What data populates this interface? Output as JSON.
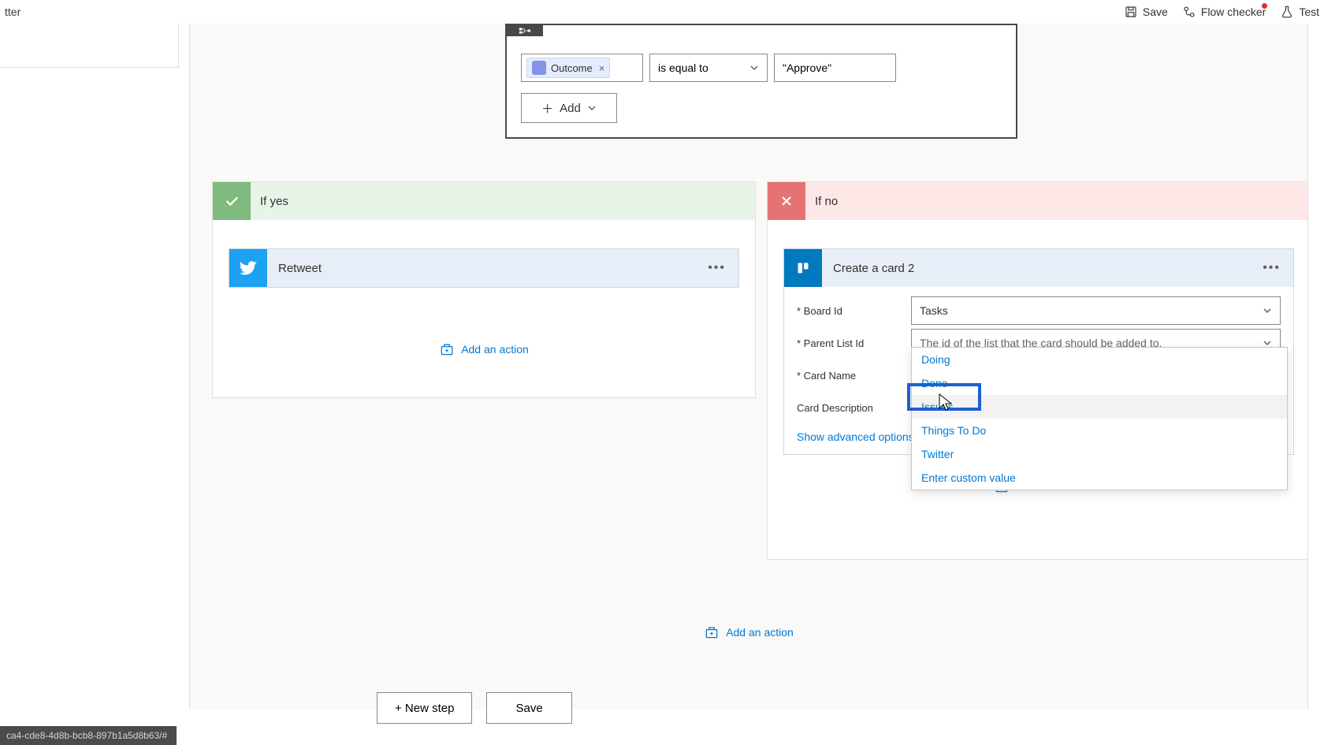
{
  "topbar": {
    "title_fragment": "tter",
    "save": "Save",
    "flow_checker": "Flow checker",
    "test": "Test"
  },
  "condition": {
    "token_label": "Outcome",
    "comparator": "is equal to",
    "value": "\"Approve\"",
    "add_label": "Add"
  },
  "yes": {
    "title": "If yes",
    "action_title": "Retweet",
    "add_action": "Add an action"
  },
  "no": {
    "title": "If no",
    "action_title": "Create a card 2",
    "add_action": "Add an action"
  },
  "trello": {
    "board_label": "* Board Id",
    "board_value": "Tasks",
    "list_label": "* Parent List Id",
    "list_placeholder": "The id of the list that the card should be added to.",
    "cardname_label": "* Card Name",
    "carddesc_label": "Card Description",
    "adv": "Show advanced options",
    "options": [
      "Doing",
      "Done",
      "Issues",
      "Things To Do",
      "Twitter",
      "Enter custom value"
    ],
    "selected_index": 2
  },
  "bottom": {
    "add_action": "Add an action",
    "new_step": "+ New step",
    "save": "Save"
  },
  "status": "ca4-cde8-4d8b-bcb8-897b1a5d8b63/#"
}
